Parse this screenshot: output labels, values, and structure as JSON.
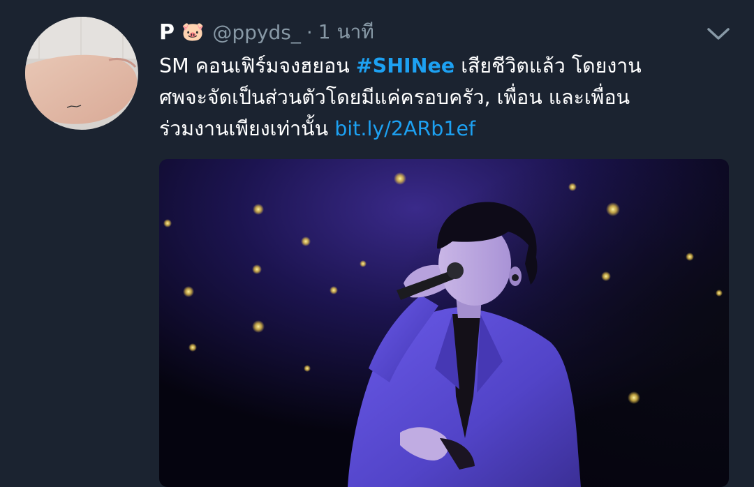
{
  "tweet": {
    "display_name": "P",
    "emoji": "🐷",
    "handle": "@ppyds_",
    "separator": "·",
    "time": "1 นาที",
    "text": {
      "part1": "SM คอนเฟิร์มจงฮยอน ",
      "hashtag": "#SHINee",
      "part2": " เสียชีวิตแล้ว โดยงาน",
      "line2": "ศพจะจัดเป็นส่วนตัวโดยมีแค่ครอบครัว, เพื่อน และเพื่อน",
      "line3": "ร่วมงานเพียงเท่านั้น ",
      "link": "bit.ly/2ARb1ef"
    }
  },
  "icons": {
    "menu": "chevron-down-icon"
  },
  "colors": {
    "background": "#1b2330",
    "link": "#1da1f2",
    "secondary_text": "#8899a6"
  }
}
